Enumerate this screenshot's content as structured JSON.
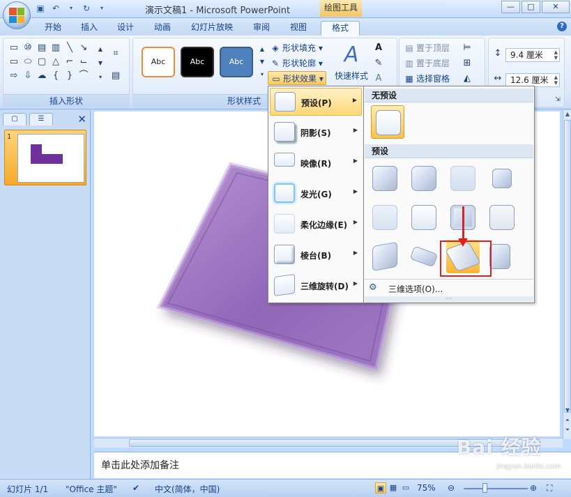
{
  "titlebar": {
    "title": "演示文稿1 - Microsoft PowerPoint",
    "context_tool": "绘图工具",
    "minimize": "—",
    "maximize": "□",
    "close": "✕"
  },
  "tabs": [
    {
      "label": "开始"
    },
    {
      "label": "插入"
    },
    {
      "label": "设计"
    },
    {
      "label": "动画"
    },
    {
      "label": "幻灯片放映"
    },
    {
      "label": "审阅"
    },
    {
      "label": "视图"
    },
    {
      "label": "格式"
    }
  ],
  "ribbon": {
    "insert_shapes_label": "插入形状",
    "shape_styles_label": "形状样式",
    "style_sample": "Abc",
    "shape_fill": "形状填充",
    "shape_outline": "形状轮廓",
    "shape_effects": "形状效果",
    "quick_styles": "快速样式",
    "bring_to_front": "置于顶层",
    "send_to_back": "置于底层",
    "selection_pane": "选择窗格",
    "height_value": "9.4 厘米",
    "width_value": "12.6 厘米"
  },
  "effects_menu": {
    "items": [
      {
        "label": "预设(P)"
      },
      {
        "label": "阴影(S)"
      },
      {
        "label": "映像(R)"
      },
      {
        "label": "发光(G)"
      },
      {
        "label": "柔化边缘(E)"
      },
      {
        "label": "棱台(B)"
      },
      {
        "label": "三维旋转(D)"
      }
    ]
  },
  "preset_panel": {
    "no_preset_header": "无预设",
    "preset_header": "预设",
    "options_label": "三维选项(O)...",
    "grip": "····"
  },
  "leftpane": {
    "slide_number": "1"
  },
  "notes": {
    "placeholder": "单击此处添加备注"
  },
  "statusbar": {
    "slide_info": "幻灯片 1/1",
    "theme": "\"Office 主题\"",
    "language": "中文(简体，中国)",
    "zoom": "75%"
  },
  "watermark": {
    "brand": "Bai 经验",
    "url": "jingyan.baidu.com"
  },
  "colors": {
    "shape_fill": "#9b72be",
    "highlight": "#e02020",
    "menu_hover": "#ffd776"
  }
}
